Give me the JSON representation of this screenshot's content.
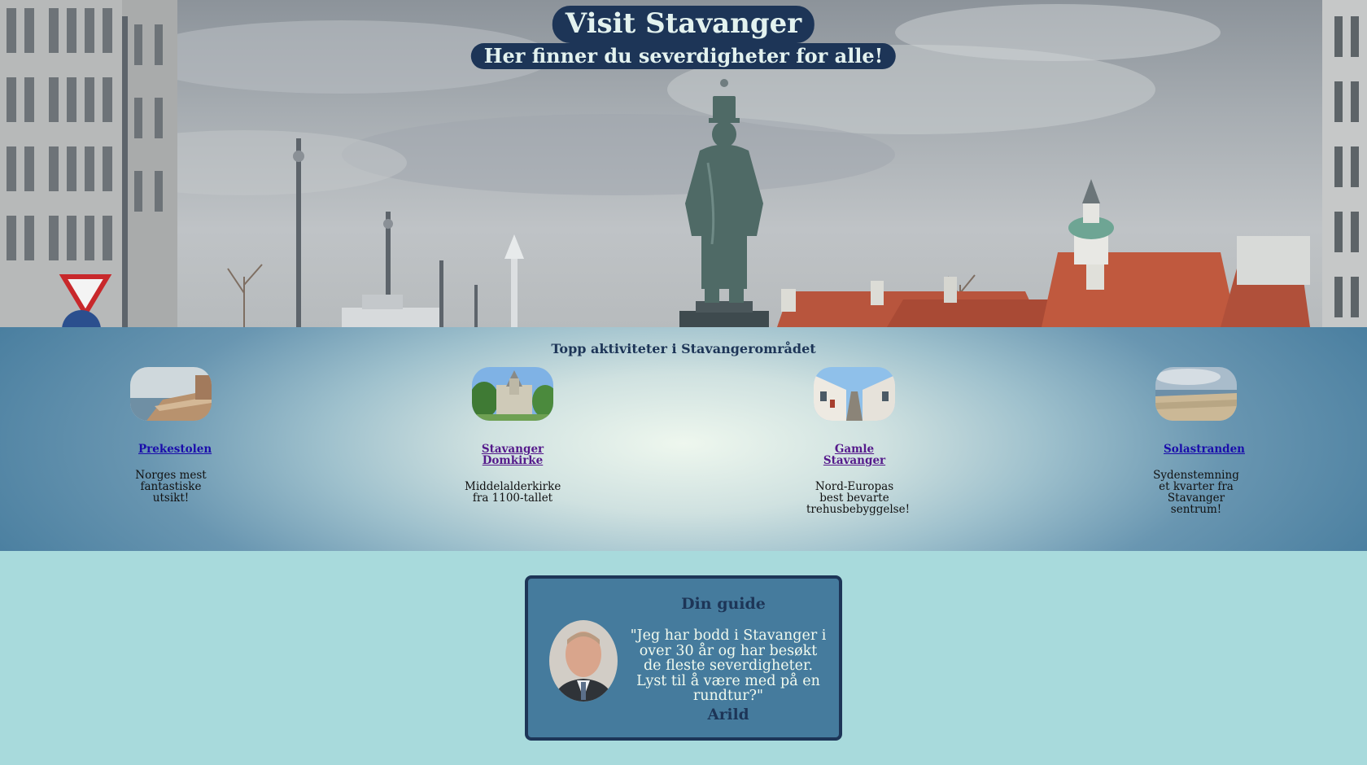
{
  "hero": {
    "title": "Visit Stavanger",
    "subtitle": "Her finner du severdigheter for alle!"
  },
  "activities": {
    "heading": "Topp aktiviteter i Stavangerområdet",
    "items": [
      {
        "name": "Prekestolen",
        "description": "Norges mest fantastiske utsikt!",
        "image": "cliff-photo"
      },
      {
        "name": "Stavanger Domkirke",
        "description": "Middelalderkirke fra 1100-tallet",
        "image": "cathedral-photo"
      },
      {
        "name": "Gamle Stavanger",
        "description": "Nord-Europas best bevarte trehusbebyggelse!",
        "image": "old-street-photo"
      },
      {
        "name": "Solastranden",
        "description": "Sydenstemning et kvarter fra Stavanger sentrum!",
        "image": "beach-photo"
      }
    ]
  },
  "guide": {
    "heading": "Din guide",
    "quote": "\"Jeg har bodd i Stavanger i over 30 år og har besøkt de fleste severdigheter. Lyst til å være med på en rundtur?\"",
    "name": "Arild",
    "image": "guide-portrait-photo"
  },
  "colors": {
    "navy": "#1d3557",
    "steel_blue": "#457b9d",
    "light_teal": "#a8dadc",
    "off_white": "#f1faee",
    "link": "#1a0dab",
    "link_visited": "#551a8b"
  }
}
